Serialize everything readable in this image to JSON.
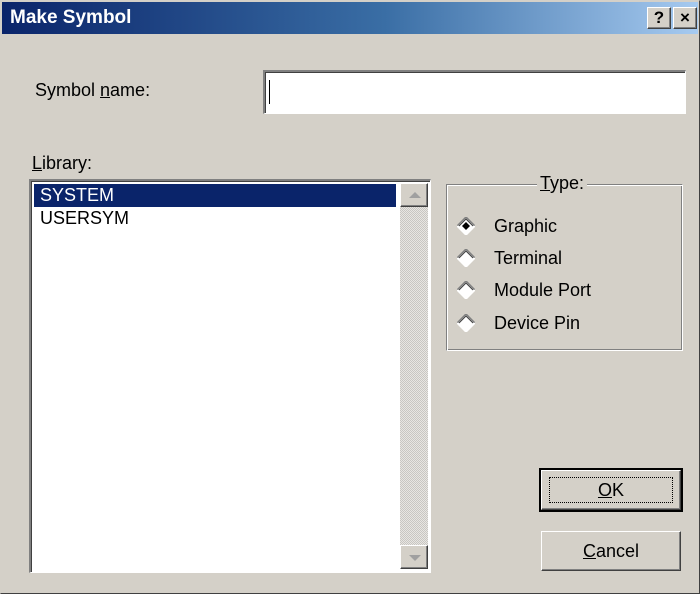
{
  "window": {
    "title": "Make Symbol",
    "help_label": "?",
    "close_label": "×"
  },
  "symbol_name": {
    "label_pre": "Symbol ",
    "label_accel": "n",
    "label_post": "ame:",
    "value": ""
  },
  "library": {
    "label_accel": "L",
    "label_post": "ibrary:",
    "items": [
      "SYSTEM",
      "USERSYM"
    ],
    "selected": "SYSTEM"
  },
  "type_group": {
    "title_accel": "T",
    "title_post": "ype:",
    "options": [
      "Graphic",
      "Terminal",
      "Module Port",
      "Device Pin"
    ],
    "selected": "Graphic"
  },
  "buttons": {
    "ok_accel": "O",
    "ok_post": "K",
    "cancel_accel": "C",
    "cancel_post": "ancel"
  }
}
